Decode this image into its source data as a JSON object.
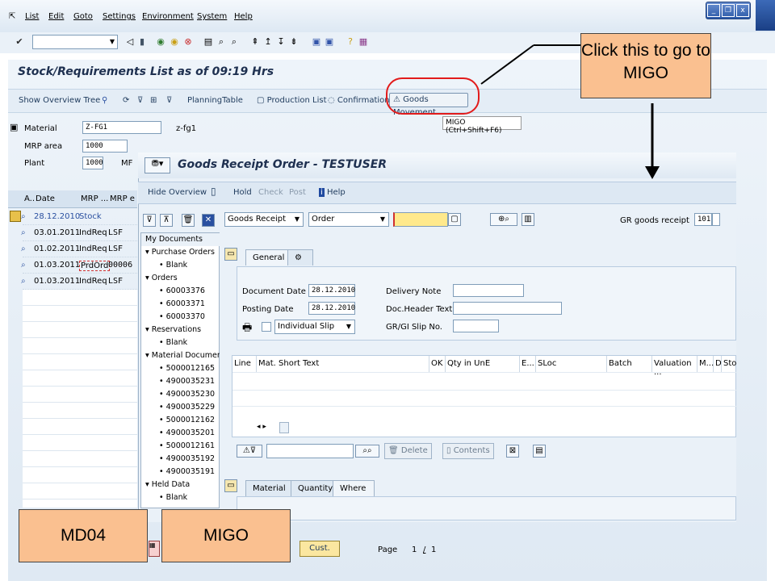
{
  "menu": {
    "items": [
      "List",
      "Edit",
      "Goto",
      "Settings",
      "Environment",
      "System",
      "Help"
    ]
  },
  "md04": {
    "title": "Stock/Requirements List as of 09:19 Hrs",
    "toolbar": {
      "show_overview_tree": "Show Overview Tree",
      "planning_table": "PlanningTable",
      "production_list": "Production List",
      "confirmation": "Confirmation",
      "goods_movement": "Goods Movement"
    },
    "tooltip": "MIGO   (Ctrl+Shift+F6)",
    "material_label": "Material",
    "material_value": "Z-FG1",
    "material_desc": "z-fg1",
    "mrp_area_label": "MRP area",
    "mrp_area_value": "1000",
    "plant_label": "Plant",
    "plant_value": "1000",
    "plant_trunc": "MF",
    "columns": [
      "A..",
      "Date",
      "MRP ...",
      "MRP e"
    ],
    "rows": [
      {
        "date": "28.12.2010",
        "mrp": "Stock",
        "el": ""
      },
      {
        "date": "03.01.2011",
        "mrp": "IndReq",
        "el": "LSF"
      },
      {
        "date": "01.02.2011",
        "mrp": "IndReq",
        "el": "LSF"
      },
      {
        "date": "01.03.2011",
        "mrp": "PrdOrd",
        "el": "00006"
      },
      {
        "date": "01.03.2011",
        "mrp": "IndReq",
        "el": "LSF"
      }
    ]
  },
  "migo": {
    "title": "Goods Receipt Order - TESTUSER",
    "toolbar": {
      "hide_overview": "Hide Overview",
      "hold": "Hold",
      "check": "Check",
      "post": "Post",
      "help": "Help"
    },
    "action": "Goods Receipt",
    "ref_doc": "Order",
    "gr_label": "GR goods receipt",
    "gr_value": "101",
    "tree": [
      {
        "t": "My Documents",
        "lvl": 0,
        "s": true
      },
      {
        "t": "▾ Purchase Orders",
        "lvl": 0
      },
      {
        "t": "• Blank",
        "lvl": 1
      },
      {
        "t": "▾ Orders",
        "lvl": 0
      },
      {
        "t": "• 60003376",
        "lvl": 1
      },
      {
        "t": "• 60003371",
        "lvl": 1
      },
      {
        "t": "• 60003370",
        "lvl": 1
      },
      {
        "t": "▾ Reservations",
        "lvl": 0
      },
      {
        "t": "• Blank",
        "lvl": 1
      },
      {
        "t": "▾ Material Documents",
        "lvl": 0
      },
      {
        "t": "• 5000012165",
        "lvl": 1
      },
      {
        "t": "• 4900035231",
        "lvl": 1
      },
      {
        "t": "• 4900035230",
        "lvl": 1
      },
      {
        "t": "• 4900035229",
        "lvl": 1
      },
      {
        "t": "• 5000012162",
        "lvl": 1
      },
      {
        "t": "• 4900035201",
        "lvl": 1
      },
      {
        "t": "• 5000012161",
        "lvl": 1
      },
      {
        "t": "• 4900035192",
        "lvl": 1
      },
      {
        "t": "• 4900035191",
        "lvl": 1
      },
      {
        "t": "▾ Held Data",
        "lvl": 0
      },
      {
        "t": "• Blank",
        "lvl": 1
      }
    ],
    "tabs": {
      "general": "General"
    },
    "doc_date_label": "Document Date",
    "doc_date": "28.12.2010",
    "post_date_label": "Posting Date",
    "post_date": "28.12.2010",
    "slip_select": "Individual Slip",
    "delivery_note_label": "Delivery Note",
    "header_text_label": "Doc.Header Text",
    "slip_no_label": "GR/GI Slip No.",
    "grid_columns": [
      "Line",
      "Mat. Short Text",
      "OK",
      "Qty in UnE",
      "E...",
      "SLoc",
      "Batch",
      "Valuation ...",
      "M...",
      "D",
      "Stoc"
    ],
    "btn_delete": "Delete",
    "btn_contents": "Contents",
    "detail_tabs": [
      "Material",
      "Quantity",
      "Where"
    ]
  },
  "bottom": {
    "cust": "Cust.",
    "page_label": "Page",
    "page": "1",
    "page_sep": "/",
    "page_total": "1"
  },
  "callouts": {
    "migo_hint": "Click this to go to MIGO",
    "md04": "MD04",
    "migo": "MIGO"
  }
}
